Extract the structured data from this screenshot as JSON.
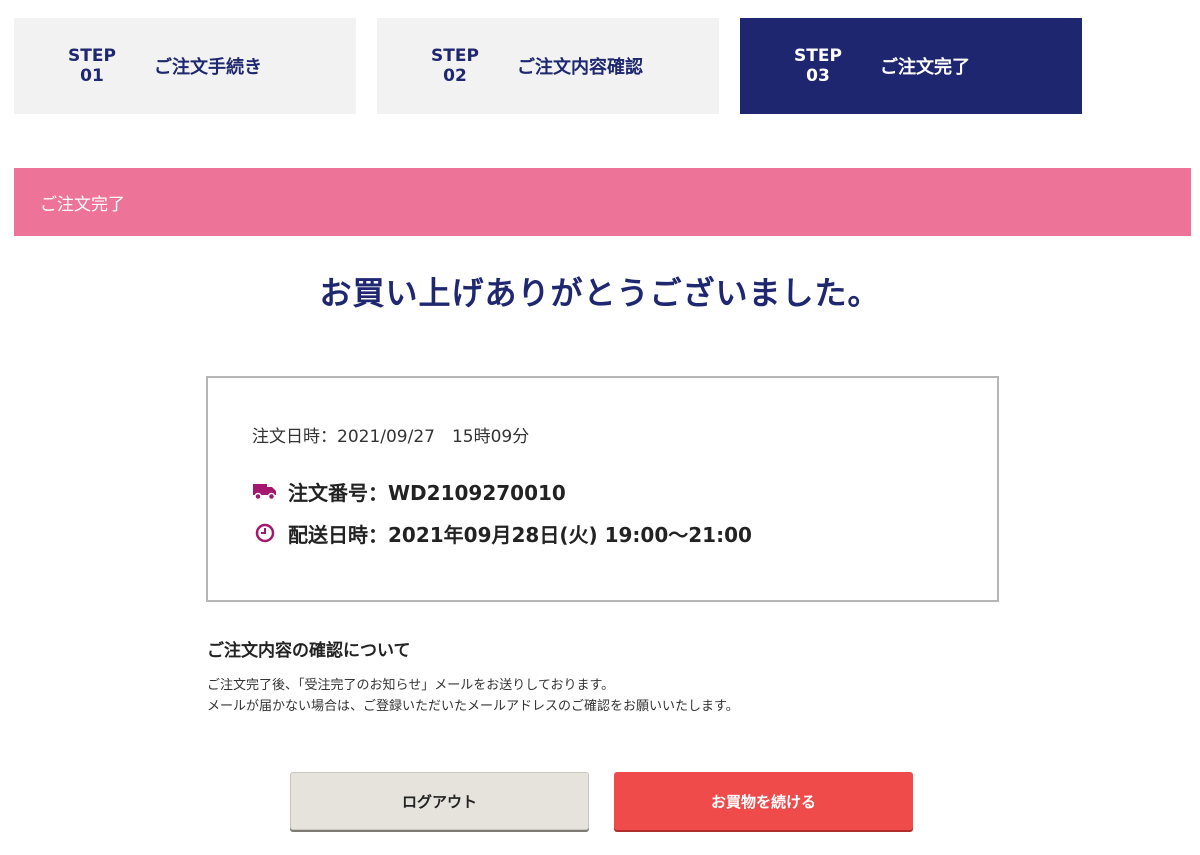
{
  "steps": [
    {
      "step_word": "STEP",
      "number": "01",
      "label": "ご注文手続き"
    },
    {
      "step_word": "STEP",
      "number": "02",
      "label": "ご注文内容確認"
    },
    {
      "step_word": "STEP",
      "number": "03",
      "label": "ご注文完了"
    }
  ],
  "section_title": "ご注文完了",
  "thanks_message": "お買い上げありがとうございました。",
  "order": {
    "datetime": "注文日時：2021/09/27　15時09分",
    "number_label": "注文番号：WD2109270010",
    "delivery_label": "配送日時：2021年09月28日(火) 19:00〜21:00",
    "truck_icon": "truck-icon",
    "clock_icon": "clock-icon"
  },
  "notice": {
    "title": "ご注文内容の確認について",
    "line1": "ご注文完了後、「受注完了のお知らせ」メールをお送りしております。",
    "line2": "メールが届かない場合は、ご登録いただいたメールアドレスのご確認をお願いいたします。"
  },
  "buttons": {
    "logout": "ログアウト",
    "continue": "お買物を続ける"
  },
  "colors": {
    "navy": "#1f2670",
    "pink": "#ed7399",
    "red": "#ee4b4a",
    "icon_magenta": "#a3176e"
  }
}
